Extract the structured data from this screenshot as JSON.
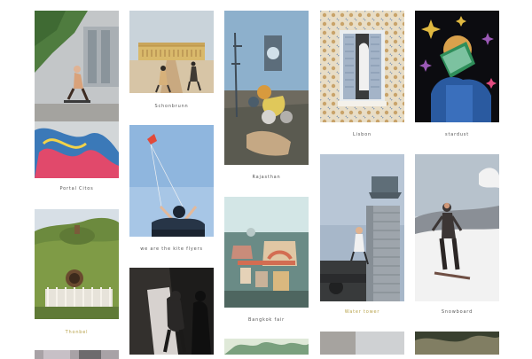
{
  "gallery": {
    "items": [
      {
        "id": "c1a",
        "caption": "Portal Citos",
        "caption_color": "#555555",
        "colors": [
          "#5f8a4c",
          "#9a9c9f",
          "#c8ccce",
          "#3b6b9e",
          "#2f8bd0"
        ]
      },
      {
        "id": "c1b",
        "caption": "Thonbel",
        "caption_color": "#b7a24a",
        "colors": [
          "#8fa34a",
          "#c9c2b6",
          "#6c8a3e",
          "#b9c3cc"
        ]
      },
      {
        "id": "c1c",
        "caption": "",
        "caption_color": "#555555",
        "colors": [
          "#a8a2a6",
          "#6d6b6d"
        ]
      },
      {
        "id": "c2a",
        "caption": "Schonbrunn",
        "caption_color": "#555555",
        "colors": [
          "#c9d3da",
          "#d9c6a6",
          "#c09668",
          "#3f3a34"
        ]
      },
      {
        "id": "c2b",
        "caption": "we are the kite flyers",
        "caption_color": "#555555",
        "colors": [
          "#8fb6de",
          "#a7c6e6",
          "#273547",
          "#f1ece4"
        ]
      },
      {
        "id": "c2c",
        "caption": "",
        "caption_color": "#555555",
        "colors": [
          "#33302d",
          "#d7d2cf",
          "#4a4846",
          "#1d1c1b"
        ]
      },
      {
        "id": "c3a",
        "caption": "Rajasthan",
        "caption_color": "#555555",
        "colors": [
          "#7f9cb7",
          "#4b5d6b",
          "#e0c85a",
          "#c5a884"
        ]
      },
      {
        "id": "c3b",
        "caption": "Bangkok fair",
        "caption_color": "#555555",
        "colors": [
          "#c4d8d8",
          "#c98c7a",
          "#6a8b86",
          "#e0c7a4"
        ]
      },
      {
        "id": "c3c",
        "caption": "",
        "caption_color": "#555555",
        "colors": [
          "#dfe9d8",
          "#7aa07e"
        ]
      },
      {
        "id": "c4a",
        "caption": "Lisbon",
        "caption_color": "#555555",
        "colors": [
          "#c9a36a",
          "#e8ddc6",
          "#a4b4c8",
          "#2a2b2d"
        ]
      },
      {
        "id": "c4b",
        "caption": "Water tower",
        "caption_color": "#b7a24a",
        "colors": [
          "#a7b7c9",
          "#9ea5ac",
          "#5f6e78",
          "#383a3b"
        ]
      },
      {
        "id": "c4c",
        "caption": "",
        "caption_color": "#555555",
        "colors": [
          "#cfd1d3",
          "#a6a39f"
        ]
      },
      {
        "id": "c5a",
        "caption": "stardust",
        "caption_color": "#555555",
        "colors": [
          "#0c0c10",
          "#2a5aa0",
          "#e0b840",
          "#e24b7f"
        ]
      },
      {
        "id": "c5b",
        "caption": "Snowboard",
        "caption_color": "#555555",
        "colors": [
          "#cbd2d8",
          "#f2f2f2",
          "#3c3635",
          "#8a8f96"
        ]
      },
      {
        "id": "c5c",
        "caption": "",
        "caption_color": "#555555",
        "colors": [
          "#39402f",
          "#a8a07f"
        ]
      }
    ]
  }
}
